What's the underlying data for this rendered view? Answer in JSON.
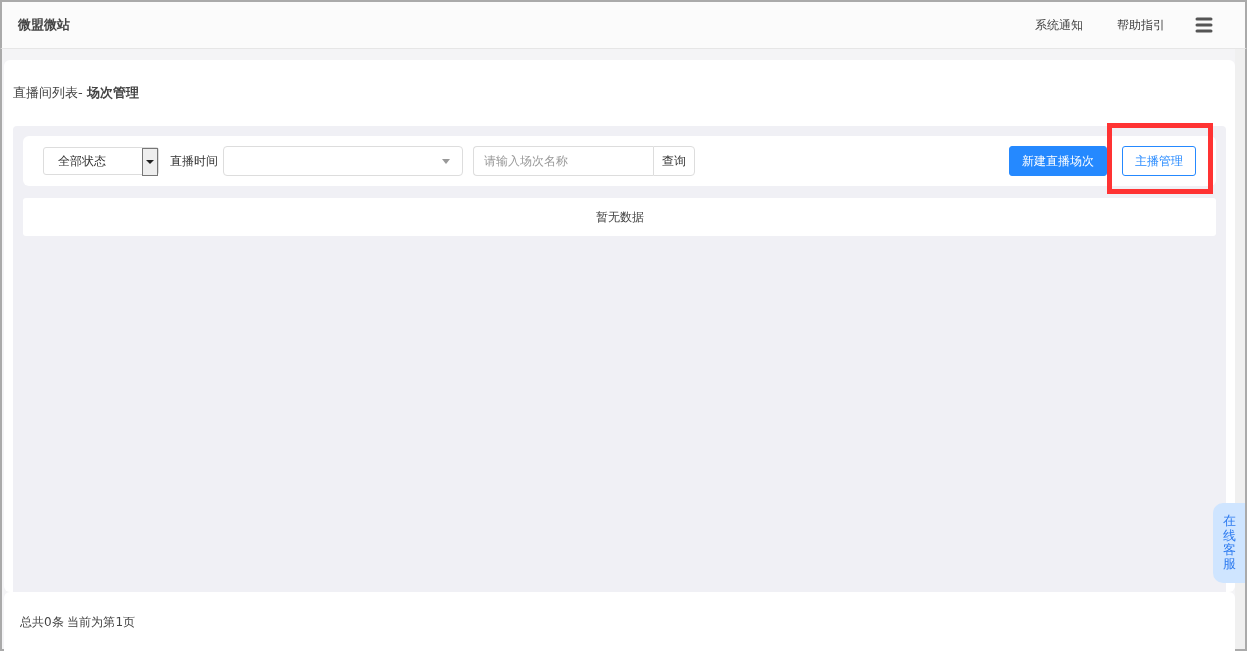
{
  "header": {
    "title": "微盟微站",
    "links": [
      "系统通知",
      "帮助指引"
    ]
  },
  "breadcrumb": {
    "parent": "直播间列表-",
    "current": "场次管理"
  },
  "filters": {
    "status_select": {
      "value": "全部状态"
    },
    "time_label": "直播时间",
    "search": {
      "placeholder": "请输入场次名称"
    },
    "query_button": "查询"
  },
  "buttons": [
    {
      "label": "新建直播场次",
      "kind": "primary",
      "highlighted": false
    },
    {
      "label": "主播管理",
      "kind": "outline",
      "highlighted": true
    }
  ],
  "table": {
    "empty_text": "暂无数据"
  },
  "footer": {
    "summary": "总共0条 当前为第1页"
  },
  "chat_tab": {
    "label": "在线客服"
  }
}
